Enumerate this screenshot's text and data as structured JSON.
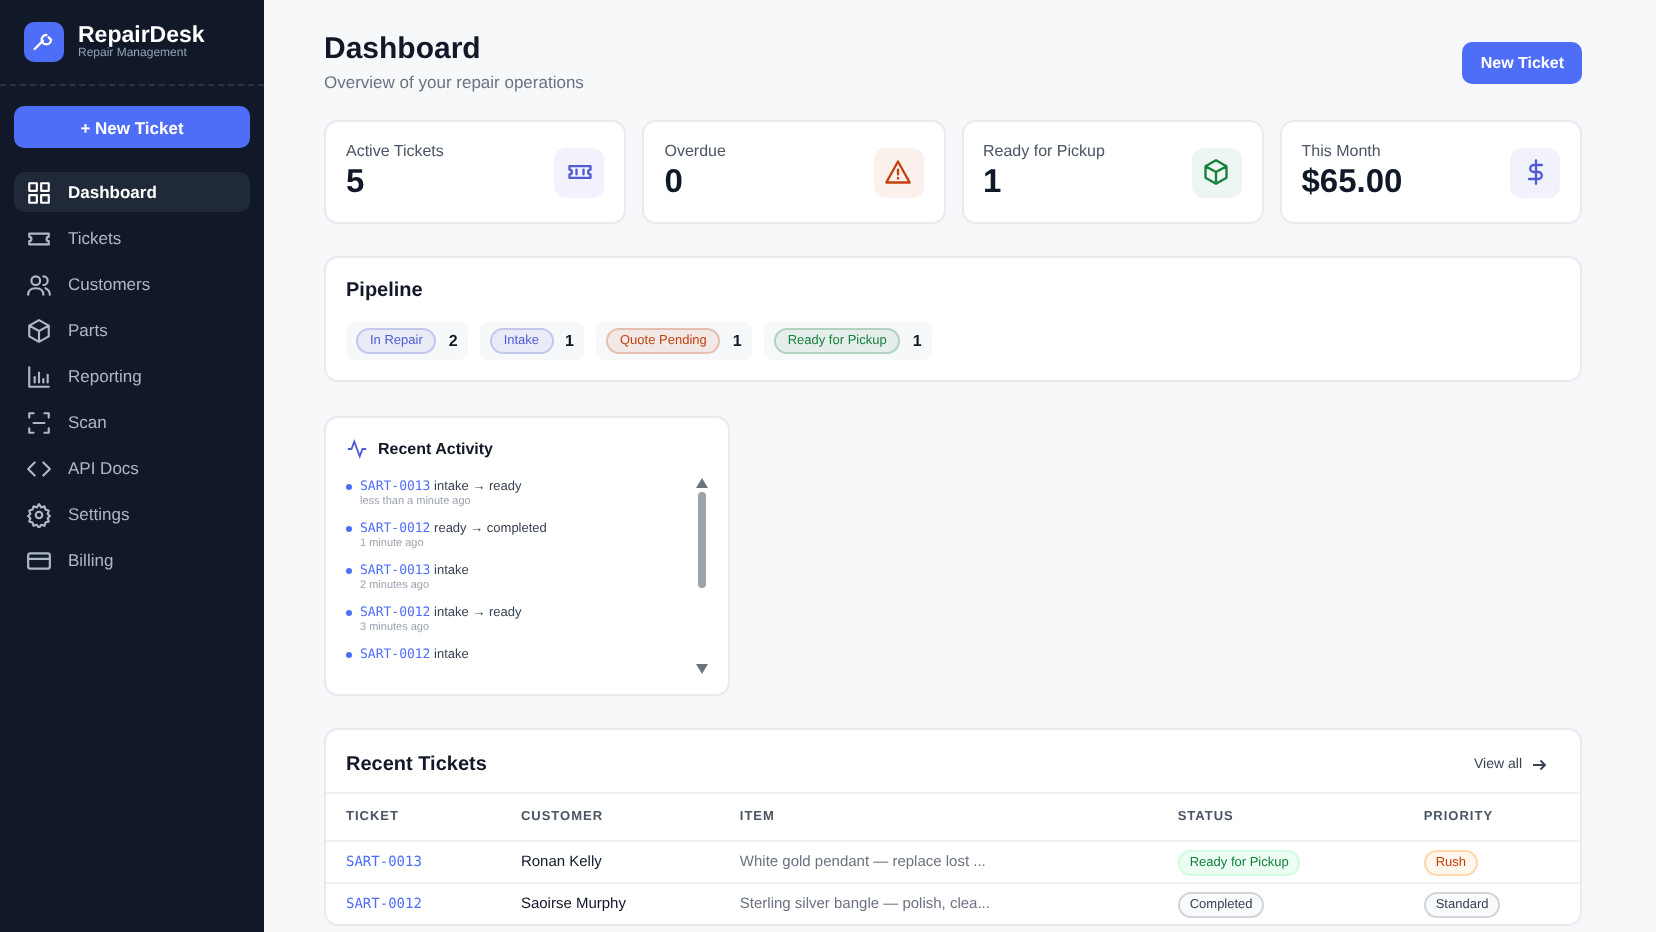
{
  "brand": {
    "name": "RepairDesk",
    "tagline": "Repair Management"
  },
  "sidebar": {
    "new_ticket": "New Ticket",
    "new_ticket_icon": "+",
    "items": [
      {
        "label": "Dashboard",
        "selected": true
      },
      {
        "label": "Tickets",
        "selected": false
      },
      {
        "label": "Customers",
        "selected": false
      },
      {
        "label": "Parts",
        "selected": false
      },
      {
        "label": "Reporting",
        "selected": false
      },
      {
        "label": "Scan",
        "selected": false
      },
      {
        "label": "API Docs",
        "selected": false
      },
      {
        "label": "Settings",
        "selected": false
      },
      {
        "label": "Billing",
        "selected": false
      }
    ]
  },
  "header": {
    "title": "Dashboard",
    "subtitle": "Overview of your repair operations",
    "button": "New Ticket"
  },
  "stats": [
    {
      "label": "Active Tickets",
      "value": "5",
      "color": "#4f5bd5"
    },
    {
      "label": "Overdue",
      "value": "0",
      "color": "#c2410c"
    },
    {
      "label": "Ready for Pickup",
      "value": "1",
      "color": "#15803d"
    },
    {
      "label": "This Month",
      "value": "$65.00",
      "color": "#4f5bd5"
    }
  ],
  "pipeline": {
    "title": "Pipeline",
    "stages": [
      {
        "label": "In Repair",
        "count": "2",
        "color": "#4f5bd5"
      },
      {
        "label": "Intake",
        "count": "1",
        "color": "#4f5bd5"
      },
      {
        "label": "Quote Pending",
        "count": "1",
        "color": "#c2410c"
      },
      {
        "label": "Ready for Pickup",
        "count": "1",
        "color": "#15803d"
      }
    ]
  },
  "activity": {
    "title": "Recent Activity",
    "items": [
      {
        "ticket": "SART-0013",
        "text": "intake → ready",
        "time": "less than a minute ago"
      },
      {
        "ticket": "SART-0012",
        "text": "ready → completed",
        "time": "1 minute ago"
      },
      {
        "ticket": "SART-0013",
        "text": "intake",
        "time": "2 minutes ago"
      },
      {
        "ticket": "SART-0012",
        "text": "intake → ready",
        "time": "3 minutes ago"
      },
      {
        "ticket": "SART-0012",
        "text": "intake"
      }
    ]
  },
  "recent_tickets": {
    "title": "Recent Tickets",
    "view_all": "View all",
    "columns": [
      "TICKET",
      "CUSTOMER",
      "ITEM",
      "STATUS",
      "PRIORITY"
    ],
    "rows": [
      {
        "ticket": "SART-0013",
        "customer": "Ronan Kelly",
        "item": "White gold pendant — replace lost ...",
        "status": {
          "text": "Ready for Pickup",
          "kind": "ready"
        },
        "priority": {
          "text": "Rush",
          "kind": "rush"
        }
      },
      {
        "ticket": "SART-0012",
        "customer": "Saoirse Murphy",
        "item": "Sterling silver bangle — polish, clea...",
        "status": {
          "text": "Completed",
          "kind": "completed"
        },
        "priority": {
          "text": "Standard",
          "kind": "standard"
        }
      }
    ]
  }
}
